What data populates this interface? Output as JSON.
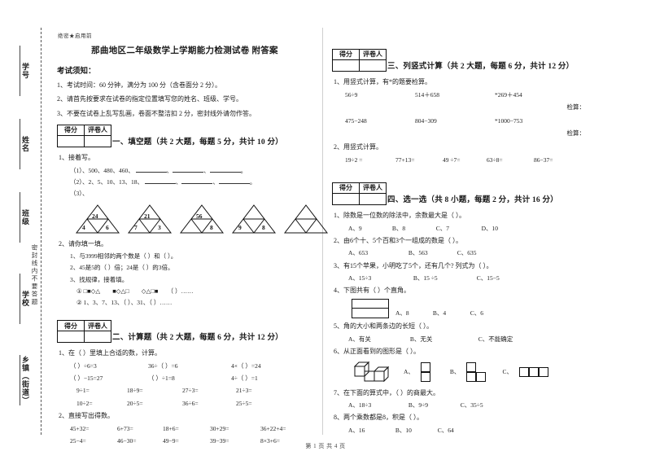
{
  "seal": {
    "secret_mark": "绝密★启用前",
    "vertical_note": "密封线内不要答题",
    "fields": [
      "学号",
      "姓名",
      "班级",
      "学校",
      "乡镇（街道）"
    ]
  },
  "header": {
    "title": "那曲地区二年级数学上学期能力检测试卷 附答案",
    "notice_title": "考试须知：",
    "notices": [
      "1、考试时间：60 分钟，满分为 100 分（含卷面分 2 分）。",
      "2、请首先按要求在试卷的指定位置填写您的姓名、班级、学号。",
      "3、不要在试卷上乱写乱画，卷面不整洁扣 2 分，密封线外请勿作答。"
    ]
  },
  "score_box": {
    "score": "得分",
    "grader": "评卷人"
  },
  "sections": [
    {
      "id": "s1",
      "title": "一、填空题（共 2 大题，每题 5 分，共计 10 分）",
      "q1_label": "1、接着写。",
      "q1_items": [
        "（1）、500、480、460、",
        "（2）、2、5、10、13、18、",
        "（3）、"
      ],
      "triangles": [
        {
          "top": "24",
          "bl": "4",
          "br": "6"
        },
        {
          "top": "21",
          "bl": "7",
          "br": "3"
        },
        {
          "top": "56",
          "bl": "",
          "br": "8"
        },
        {
          "top": "",
          "bl": "9",
          "br": "8"
        },
        {
          "top": "",
          "bl": "",
          "br": ""
        }
      ],
      "q2_label": "2、请你填一填。",
      "q2_items": [
        "1、与3999相邻的两个数是（                ）和（              ）。",
        "2、45是5的（             ）倍；24是（             ）的3倍。",
        "3、找规律，接着填。"
      ],
      "q2_sub": [
        "① □■◇△　　■◇△□　　◇△□■　　（                         ）……",
        "② 1、3、7、13、（         ）、31、（              ）……"
      ]
    },
    {
      "id": "s2",
      "title": "二、计算题（共 2 大题，每题 6 分，共计 12 分）",
      "q1_label": "1、在（    ）里填上合适的数，计算。",
      "q1_rows": [
        [
          "（      ）÷6=3",
          "36÷（      ）=6",
          "4×（      ）=24"
        ],
        [
          "（      ）−15=27",
          "（      ）÷1=8",
          "4÷（      ）=1"
        ],
        [
          "9÷1=",
          "18÷9=",
          "27÷3=",
          "21÷3="
        ],
        [
          "10÷2=",
          "20÷5=",
          "36÷6=",
          "25÷5="
        ]
      ],
      "q2_label": "2、直接写出得数。",
      "q2_rows": [
        [
          "45+32=",
          "6+73=",
          "18+6=",
          "30+29=",
          "36+22+4="
        ],
        [
          "25−4=",
          "46−30=",
          "49−9=",
          "39−39=",
          "8×3+6="
        ]
      ]
    },
    {
      "id": "s3",
      "title": "三、列竖式计算（共 2 大题，每题 6 分，共计 12 分）",
      "q1_label": "1、用竖式计算，有*的题要检算。",
      "q1_rows": [
        [
          "56÷9",
          "514＋658",
          "*269＋454"
        ],
        [
          "475−248",
          "804−309",
          "*1000−753"
        ]
      ],
      "check_label": "检算：",
      "q2_label": "2、用竖式计算。",
      "q2_row": [
        "19÷2 =",
        "77+13=",
        "49 ÷7=",
        "63÷8=",
        "86−37="
      ]
    },
    {
      "id": "s4",
      "title": "四、选一选（共 8 小题，每题 2 分，共计 16 分）",
      "questions": [
        {
          "stem": "1、除数是一位数的除法中，余数最大是（      ）。",
          "options": [
            "A、9",
            "B、8",
            "C、7",
            "D、10"
          ]
        },
        {
          "stem": "2、由6个十、5个百和3个一组成的数是（        ）。",
          "options": [
            "A、653",
            "B、563",
            "C、635"
          ]
        },
        {
          "stem": "3、有15个苹果，小明吃了5个，还有几个? 列式为（        ）。",
          "options": [
            "A、15÷3",
            "B、15 ÷5",
            "C、15−5"
          ]
        },
        {
          "stem": "4、下图共有（     ）个直角。",
          "options": [
            "A、8",
            "B、4",
            "C、6"
          ]
        },
        {
          "stem": "5、角的大小和两条边的长短（      ）。",
          "options": [
            "A、有关",
            "B、无关",
            "C、不能确定"
          ]
        },
        {
          "stem": "6、从正面看到的图形是（      ）。",
          "options": [
            "A、",
            "B、",
            "C、"
          ]
        },
        {
          "stem": "7、在下面的算式中，（      ）的商最大。",
          "options": [
            "A、18÷3",
            "B、9÷9",
            "C、35÷5"
          ]
        },
        {
          "stem": "8、两个乘数都是8，积是（      ）。",
          "options": [
            "A、16",
            "B、10",
            "C、64"
          ]
        }
      ]
    }
  ],
  "footer": "第 1 页 共 4 页"
}
